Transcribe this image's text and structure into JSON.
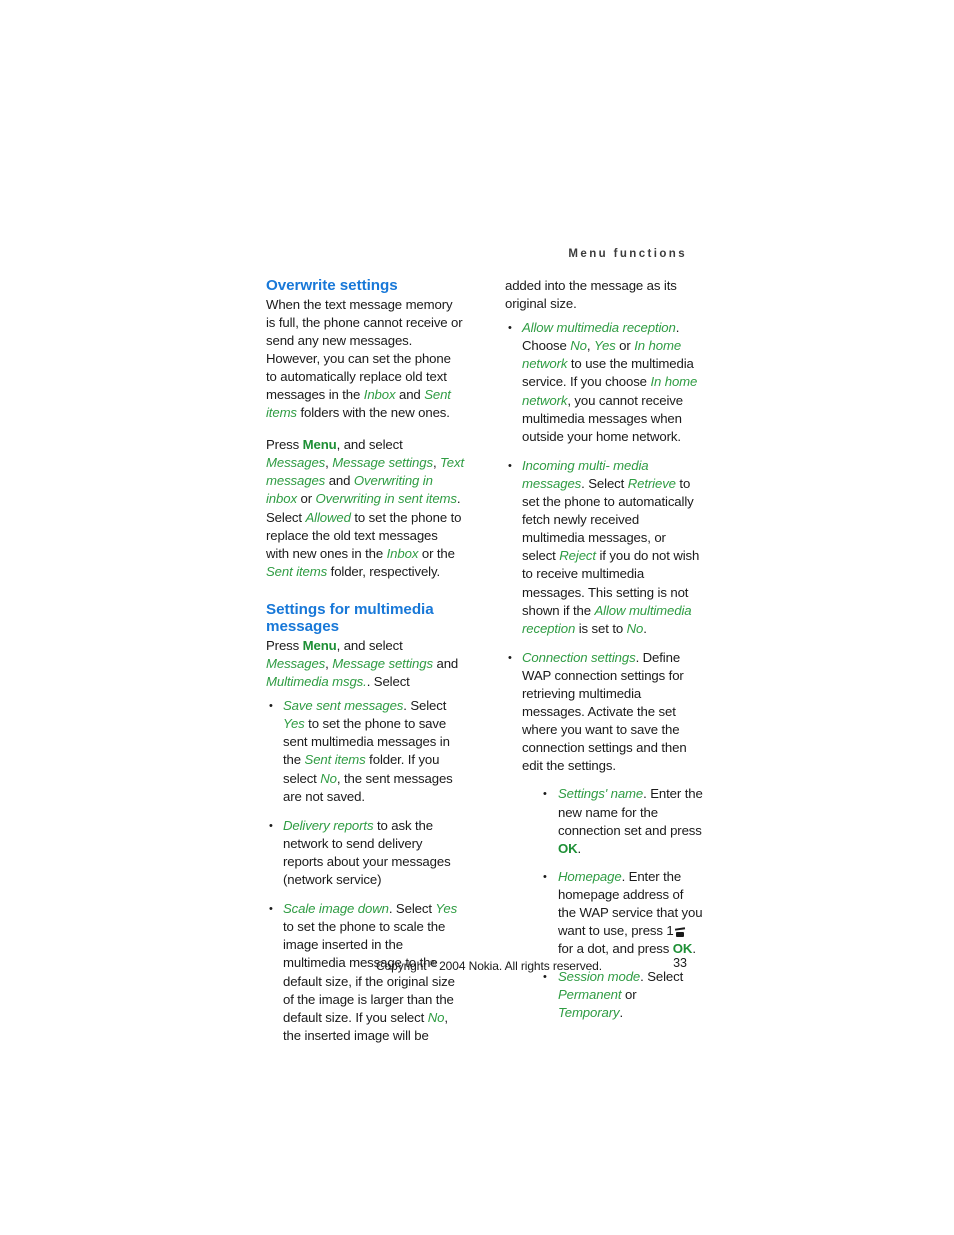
{
  "header": {
    "running_title": "Menu functions"
  },
  "footer": {
    "copyright_prefix": "Copyright ",
    "registered_mark": "®",
    "copyright_suffix": " 2004 Nokia. All rights reserved.",
    "page_number": "33"
  },
  "colors": {
    "heading_blue": "#1878d8",
    "term_green": "#2f9c43",
    "key_green": "#1d8f35",
    "body_text": "#1a1a1a",
    "header_gray": "#3c3c3c"
  },
  "left_column": {
    "heading_1": "Overwrite settings",
    "para_1": {
      "t1": "When the text message memory is full, the phone cannot receive or send any new messages. However, you can set the phone to automatically replace old text messages in the ",
      "term_inbox": "Inbox",
      "t2": " and ",
      "term_sent_items": "Sent items",
      "t3": " folders with the new ones."
    },
    "para_2": {
      "t1": "Press ",
      "key_menu": "Menu",
      "t2": ", and select ",
      "term_messages": "Messages",
      "t3": ", ",
      "term_message_settings": "Message settings",
      "t4": ", ",
      "term_text_messages": "Text messages",
      "t5": " and ",
      "term_overwriting_inbox": "Overwriting in inbox",
      "t6": " or ",
      "term_overwriting_sent": "Overwriting in sent items",
      "t7": ". Select ",
      "term_allowed": "Allowed",
      "t8": " to set the phone to replace the old text messages with new ones in the ",
      "term_inbox": "Inbox",
      "t9": " or the ",
      "term_sent_items": "Sent items",
      "t10": " folder, respectively."
    },
    "heading_2": "Settings for multimedia messages",
    "para_3": {
      "t1": "Press ",
      "key_menu": "Menu",
      "t2": ", and select ",
      "term_messages": "Messages",
      "t3": ", ",
      "term_message_settings": "Message settings",
      "t4": " and ",
      "term_multimedia_msgs": "Multimedia msgs.",
      "t5": ". Select"
    },
    "bullets": [
      {
        "bullet_glyph": "•",
        "term_1": "Save sent messages",
        "t1": ". Select ",
        "term_2": "Yes",
        "t2": " to set the phone to save sent multimedia messages in the ",
        "term_3": "Sent items",
        "t3": " folder. If you select ",
        "term_4": "No",
        "t4": ", the sent messages are not saved."
      },
      {
        "bullet_glyph": "•",
        "term_1": "Delivery reports",
        "t1": " to ask the network to send delivery reports about your messages (network service)"
      },
      {
        "bullet_glyph": "•",
        "term_1": "Scale image down",
        "t1": ". Select ",
        "term_2": "Yes",
        "t2": " to set the phone to scale the image inserted in the multimedia message to the default size, if the original size of the image is larger than the default size. If you select ",
        "term_3": "No",
        "t3": ", the inserted image will be"
      }
    ]
  },
  "right_column": {
    "para_continued": "added into the message as its original size.",
    "bullets": [
      {
        "bullet_glyph": "•",
        "term_1": "Allow multimedia reception",
        "t1": ". Choose ",
        "term_2": "No",
        "t2": ", ",
        "term_3": "Yes",
        "t3": " or ",
        "term_4": "In home network",
        "t4": " to use the multimedia service. If you choose ",
        "term_5": "In home network",
        "t5": ", you cannot receive multimedia messages when outside your home network."
      },
      {
        "bullet_glyph": "•",
        "term_1": "Incoming multi- media messages",
        "t1": ". Select ",
        "term_2": "Retrieve",
        "t2": " to set the phone to automatically fetch newly received multimedia messages, or select ",
        "term_3": "Reject",
        "t3": " if you do not wish to receive multimedia messages. This setting is not shown if the ",
        "term_4": "Allow multimedia reception",
        "t4": " is set to ",
        "term_5": "No",
        "t5": "."
      },
      {
        "bullet_glyph": "•",
        "term_1": "Connection settings",
        "t1": ". Define WAP connection settings for retrieving multimedia messages. Activate the set where you want to save the connection settings and then edit the settings.",
        "sub_bullets": [
          {
            "bullet_glyph": "•",
            "term_1": "Settings' name",
            "t1": ". Enter the new name for the connection set and press ",
            "key_1": "OK",
            "t2": "."
          },
          {
            "bullet_glyph": "•",
            "term_1": "Homepage",
            "t1": ". Enter the homepage address of the WAP service that you want to use, press 1",
            "key_icon": "voicemail-key-icon",
            "t2": " for a dot, and press ",
            "key_1": "OK",
            "t3": "."
          },
          {
            "bullet_glyph": "•",
            "term_1": "Session mode",
            "t1": ". Select ",
            "term_2": "Permanent",
            "t2": " or ",
            "term_3": "Temporary",
            "t3": "."
          }
        ]
      }
    ]
  }
}
